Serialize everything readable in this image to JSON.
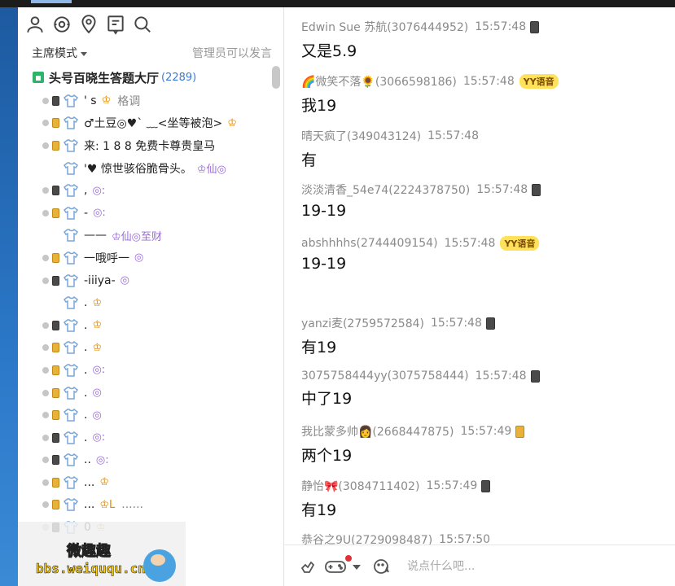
{
  "toolbar": {
    "icons": [
      "user-icon",
      "clock-face-icon",
      "location-pin-icon",
      "list-panel-icon",
      "search-icon"
    ]
  },
  "left": {
    "mode_label": "主席模式",
    "admin_note": "管理员可以发言",
    "channel": {
      "name": "头号百晓生答题大厅",
      "count": "(2289)"
    },
    "users": [
      {
        "device": "dark",
        "name": "' s",
        "badges": "♔",
        "extra": "格调",
        "extra_grey": true
      },
      {
        "device": "gold",
        "name": "♂土豆◎♥` ﹏<坐等被泡>",
        "badges": "♔"
      },
      {
        "device": "gold",
        "name": "来: 1 8 8 免费卡尊贵皇马",
        "badges": ""
      },
      {
        "device": "none",
        "name": "'♥  惊世骇俗脆骨头。",
        "badges": "♔仙◎"
      },
      {
        "device": "dark",
        "name": ",",
        "badges": "◎:"
      },
      {
        "device": "gold",
        "name": "-",
        "badges": "◎:"
      },
      {
        "device": "none",
        "name": "——",
        "badges": "♔仙◎至财"
      },
      {
        "device": "gold",
        "name": "一哦呼一",
        "badges": "◎"
      },
      {
        "device": "dark",
        "name": "-iiiya-",
        "badges": "◎"
      },
      {
        "device": "none",
        "name": ".",
        "badges": "♔"
      },
      {
        "device": "dark",
        "name": ".",
        "badges": "♔"
      },
      {
        "device": "gold",
        "name": ".",
        "badges": "♔"
      },
      {
        "device": "gold",
        "name": ".",
        "badges": "◎:"
      },
      {
        "device": "gold",
        "name": ".",
        "badges": "◎"
      },
      {
        "device": "gold",
        "name": ".",
        "badges": "◎"
      },
      {
        "device": "dark",
        "name": ".",
        "badges": "◎:"
      },
      {
        "device": "dark",
        "name": "..",
        "badges": "◎:"
      },
      {
        "device": "gold",
        "name": "...",
        "badges": "♔"
      },
      {
        "device": "gold",
        "name": "...",
        "badges": "♔L",
        "extra": "......",
        "extra_grey": true
      },
      {
        "device": "dark",
        "name": "0",
        "badges": "♔"
      }
    ]
  },
  "watermark": {
    "title": "微趣趣",
    "url": "bbs.weiququ.cn"
  },
  "chat": {
    "messages": [
      {
        "sender": "Edwin Sue 苏航(3076444952)",
        "time": "15:57:48",
        "device": "dark",
        "yy": "",
        "text": "又是5.9"
      },
      {
        "sender": "🌈微笑不落🌻(3066598186)",
        "time": "15:57:48",
        "device": "none",
        "yy": "YY语音",
        "text": "我19"
      },
      {
        "sender": "晴天疯了(349043124)",
        "time": "15:57:48",
        "device": "none",
        "yy": "",
        "text": "有"
      },
      {
        "sender": "淡淡清香_54e74(2224378750)",
        "time": "15:57:48",
        "device": "dark",
        "yy": "",
        "text": "19-19"
      },
      {
        "sender": "abshhhhs(2744409154)",
        "time": "15:57:48",
        "device": "none",
        "yy": "YY语音",
        "text": "19-19"
      },
      {
        "sender": "yanzi麦(2759572584)",
        "time": "15:57:48",
        "device": "dark",
        "yy": "",
        "text": "有19"
      },
      {
        "sender": "3075758444yy(3075758444)",
        "time": "15:57:48",
        "device": "dark",
        "yy": "",
        "text": "中了19"
      },
      {
        "sender": "我比蒙多帅👩(2668447875)",
        "time": "15:57:49",
        "device": "gold",
        "yy": "",
        "text": "两个19"
      },
      {
        "sender": "静怡🎀(3084711402)",
        "time": "15:57:49",
        "device": "dark",
        "yy": "",
        "text": "有19"
      },
      {
        "sender": "恭谷之9U(2729098487)",
        "time": "15:57:50",
        "device": "none",
        "yy": "",
        "text": ""
      }
    ]
  },
  "input": {
    "placeholder": "说点什么吧...",
    "icons": [
      "gesture-icon",
      "gamepad-icon",
      "dropdown-caret-icon",
      "emoji-icon"
    ]
  }
}
